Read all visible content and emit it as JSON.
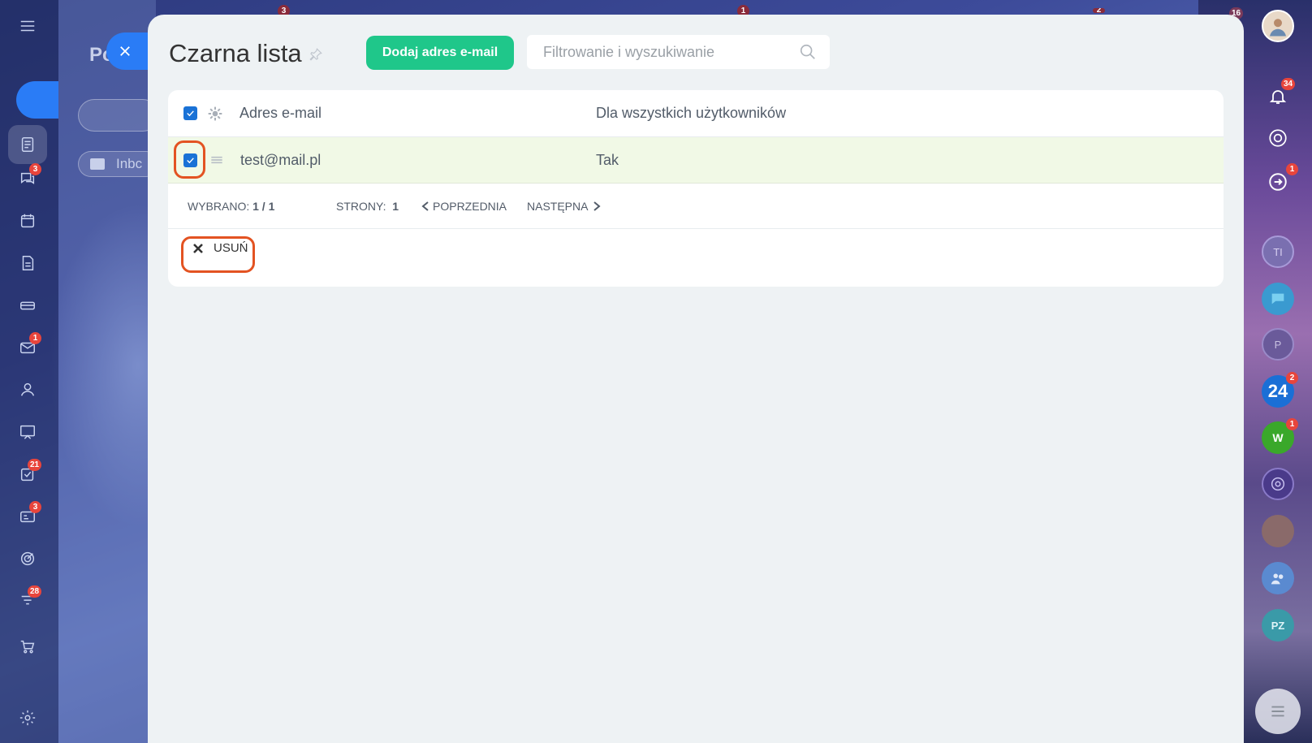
{
  "background": {
    "partial_title": "Pc",
    "inbox_pill": "Inbc",
    "top_counters": [
      "3",
      "1",
      "2",
      "16"
    ]
  },
  "left_rail": {
    "items": [
      {
        "icon": "menu-icon",
        "badge": ""
      },
      {
        "icon": "feed-icon",
        "badge": ""
      },
      {
        "icon": "chat-icon",
        "badge": "3"
      },
      {
        "icon": "calendar-icon",
        "badge": ""
      },
      {
        "icon": "document-icon",
        "badge": ""
      },
      {
        "icon": "drive-icon",
        "badge": ""
      },
      {
        "icon": "mail-icon",
        "badge": "1"
      },
      {
        "icon": "contacts-icon",
        "badge": ""
      },
      {
        "icon": "board-icon",
        "badge": ""
      },
      {
        "icon": "tasks-icon",
        "badge": "21"
      },
      {
        "icon": "crm-icon",
        "badge": "3"
      },
      {
        "icon": "target-icon",
        "badge": ""
      },
      {
        "icon": "funnel-icon",
        "badge": "28"
      },
      {
        "icon": "cart-icon",
        "badge": ""
      },
      {
        "icon": "settings-icon",
        "badge": ""
      }
    ]
  },
  "right_rail": {
    "notifications_badge": "34",
    "chat_badge": "1",
    "avatars": [
      "TI",
      "P",
      "W",
      "PZ"
    ],
    "b24_label": "24",
    "b24_badge": "2",
    "w_badge": "1"
  },
  "slider": {
    "title": "Czarna lista",
    "add_button": "Dodaj adres e-mail",
    "search_placeholder": "Filtrowanie i wyszukiwanie",
    "grid": {
      "headers": [
        "Adres e-mail",
        "Dla wszystkich użytkowników"
      ],
      "rows": [
        {
          "email": "test@mail.pl",
          "all_users": "Tak",
          "checked": true
        }
      ]
    },
    "nav": {
      "selected_label": "WYBRANO:",
      "selected_value": "1 / 1",
      "pages_label": "STRONY:",
      "pages_value": "1",
      "prev": "POPRZEDNIA",
      "next": "NASTĘPNA"
    },
    "delete_button": "USUŃ"
  },
  "colors": {
    "accent_green": "#1fc78a",
    "accent_blue": "#2a7cf6",
    "checkbox_blue": "#1a72d6",
    "highlight_orange": "#e35322",
    "selected_row": "#f1f9e6"
  }
}
